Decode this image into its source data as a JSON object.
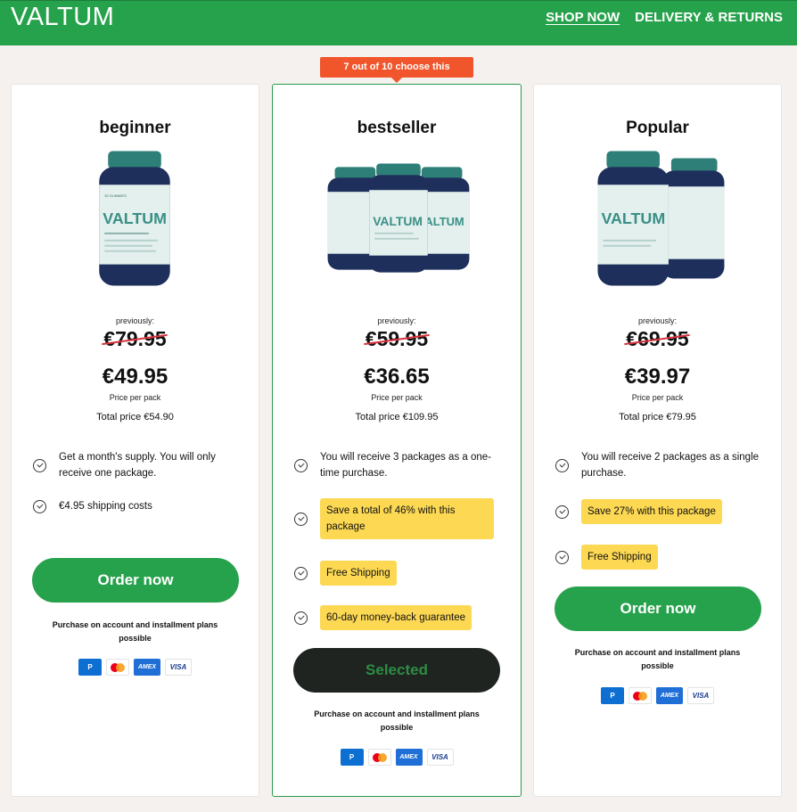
{
  "header": {
    "logo": "VALTUM",
    "nav": [
      "SHOP NOW",
      "DELIVERY & RETURNS"
    ]
  },
  "tag": "7 out of 10 choose this",
  "cards": [
    {
      "title": "beginner",
      "previously": "previously:",
      "old_price": "€79.95",
      "new_price": "€49.95",
      "per_pack": "Price per pack",
      "total": "Total price €54.90",
      "features": [
        "Get a month's supply. You will only receive one package.",
        "€4.95 shipping costs"
      ],
      "button": "Order now",
      "note": "Purchase on account and installment plans possible"
    },
    {
      "title": "bestseller",
      "previously": "previously:",
      "old_price": "€59.95",
      "new_price": "€36.65",
      "per_pack": "Price per pack",
      "total": "Total price €109.95",
      "features": [
        "You will receive 3 packages as a one-time purchase.",
        "Save a total of 46% with this package",
        "Free Shipping",
        "60-day money-back guarantee"
      ],
      "button": "Selected",
      "note": "Purchase on account and installment plans possible"
    },
    {
      "title": "Popular",
      "previously": "previously:",
      "old_price": "€69.95",
      "new_price": "€39.97",
      "per_pack": "Price per pack",
      "total": "Total price €79.95",
      "features": [
        "You will receive 2 packages as a single purchase.",
        "Save 27% with this package",
        "Free Shipping"
      ],
      "button": "Order now",
      "note": "Purchase on account and installment plans possible"
    }
  ],
  "payment": {
    "paypal_icon": "paypal-icon",
    "mastercard_icon": "mastercard-icon",
    "amex_label": "AMEX",
    "visa_label": "VISA"
  },
  "product_label": {
    "brand": "VALTUM",
    "small": "30 GUMMIES"
  },
  "colors": {
    "brand_green": "#27a24c",
    "tag_orange": "#f0552b",
    "highlight_yellow": "#fcd853",
    "strike_red": "#d8333e",
    "selected_dark": "#1f2420"
  }
}
